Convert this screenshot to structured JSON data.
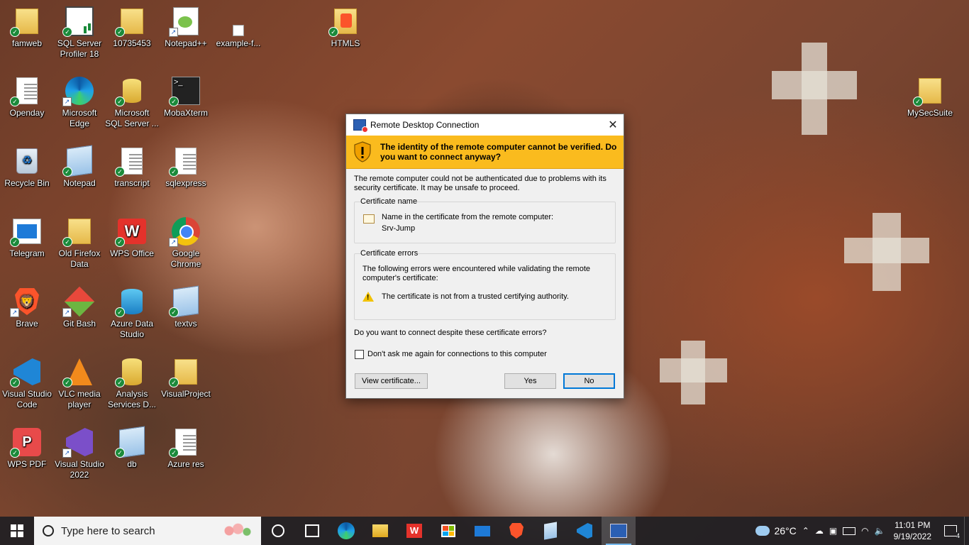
{
  "desktop": {
    "icons": [
      {
        "label": "famweb",
        "icon": "folder-icon"
      },
      {
        "label": "SQL Server Profiler 18",
        "icon": "sql-profiler-icon"
      },
      {
        "label": "10735453",
        "icon": "folder-icon"
      },
      {
        "label": "Notepad++",
        "icon": "notepadpp-icon"
      },
      {
        "label": "example-f...",
        "icon": "file-icon"
      },
      {
        "label": "HTMLS",
        "icon": "folder-icon"
      },
      {
        "label": "Openday",
        "icon": "document-icon"
      },
      {
        "label": "Microsoft Edge",
        "icon": "edge-icon"
      },
      {
        "label": "Microsoft SQL Server ...",
        "icon": "sql-server-icon"
      },
      {
        "label": "MobaXterm",
        "icon": "mobaxterm-icon"
      },
      {
        "label": "MySecSuite",
        "icon": "folder-icon"
      },
      {
        "label": "Recycle Bin",
        "icon": "recycle-bin-icon"
      },
      {
        "label": "Notepad",
        "icon": "notepad-icon"
      },
      {
        "label": "transcript",
        "icon": "document-icon"
      },
      {
        "label": "sqlexpress",
        "icon": "document-icon"
      },
      {
        "label": "Telegram",
        "icon": "telegram-icon"
      },
      {
        "label": "Old Firefox Data",
        "icon": "folder-icon"
      },
      {
        "label": "WPS Office",
        "icon": "wps-office-icon"
      },
      {
        "label": "Google Chrome",
        "icon": "chrome-icon"
      },
      {
        "label": "Brave",
        "icon": "brave-icon"
      },
      {
        "label": "Git Bash",
        "icon": "git-bash-icon"
      },
      {
        "label": "Azure Data Studio",
        "icon": "azure-data-studio-icon"
      },
      {
        "label": "textvs",
        "icon": "notepad-icon"
      },
      {
        "label": "Visual Studio Code",
        "icon": "vscode-icon"
      },
      {
        "label": "VLC media player",
        "icon": "vlc-icon"
      },
      {
        "label": "Analysis Services D...",
        "icon": "analysis-services-icon"
      },
      {
        "label": "VisualProject",
        "icon": "folder-icon"
      },
      {
        "label": "WPS PDF",
        "icon": "wps-pdf-icon"
      },
      {
        "label": "Visual Studio 2022",
        "icon": "visual-studio-icon"
      },
      {
        "label": "db",
        "icon": "notepad-icon"
      },
      {
        "label": "Azure res",
        "icon": "document-icon"
      }
    ]
  },
  "dialog": {
    "title": "Remote Desktop Connection",
    "warning": "The identity of the remote computer cannot be verified. Do you want to connect anyway?",
    "intro": "The remote computer could not be authenticated due to problems with its security certificate. It may be unsafe to proceed.",
    "cert_name_group": "Certificate name",
    "cert_name_label": "Name in the certificate from the remote computer:",
    "cert_name_value": "Srv-Jump",
    "cert_errors_group": "Certificate errors",
    "cert_errors_intro": "The following errors were encountered while validating the remote computer's certificate:",
    "cert_error_1": "The certificate is not from a trusted certifying authority.",
    "question": "Do you want to connect despite these certificate errors?",
    "dont_ask_label": "Don't ask me again for connections to this computer",
    "dont_ask_checked": false,
    "view_cert_button": "View certificate...",
    "yes_button": "Yes",
    "no_button": "No"
  },
  "taskbar": {
    "search_placeholder": "Type here to search",
    "weather_temp": "26°C",
    "clock_time": "11:01 PM",
    "clock_date": "9/19/2022",
    "notification_count": "4",
    "pinned": [
      "task-view",
      "edge",
      "file-explorer",
      "wps",
      "store",
      "mail",
      "brave",
      "notepad",
      "vscode",
      "remote-desktop"
    ]
  },
  "colors": {
    "warning_banner": "#fabb1e",
    "taskbar": "#202024",
    "primary_button_border": "#0078d7"
  }
}
